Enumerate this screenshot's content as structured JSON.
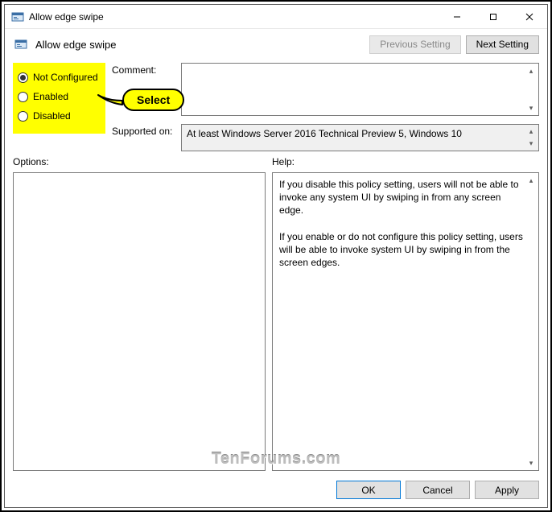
{
  "window": {
    "title": "Allow edge swipe",
    "subtitle": "Allow edge swipe"
  },
  "nav": {
    "previous": "Previous Setting",
    "next": "Next Setting"
  },
  "radios": {
    "not_configured": "Not Configured",
    "enabled": "Enabled",
    "disabled": "Disabled",
    "selected": "not_configured"
  },
  "callout": {
    "text": "Select"
  },
  "fields": {
    "comment_label": "Comment:",
    "comment_value": "",
    "supported_label": "Supported on:",
    "supported_value": "At least Windows Server 2016 Technical Preview 5, Windows 10"
  },
  "sections": {
    "options_label": "Options:",
    "help_label": "Help:",
    "options_body": "",
    "help_body_p1": "If you disable this policy setting, users will not be able to invoke any system UI by swiping in from any screen edge.",
    "help_body_p2": "If you enable or do not configure this policy setting, users will be able to invoke system UI by swiping in from the screen edges."
  },
  "footer": {
    "ok": "OK",
    "cancel": "Cancel",
    "apply": "Apply"
  },
  "watermark": "TenForums.com"
}
